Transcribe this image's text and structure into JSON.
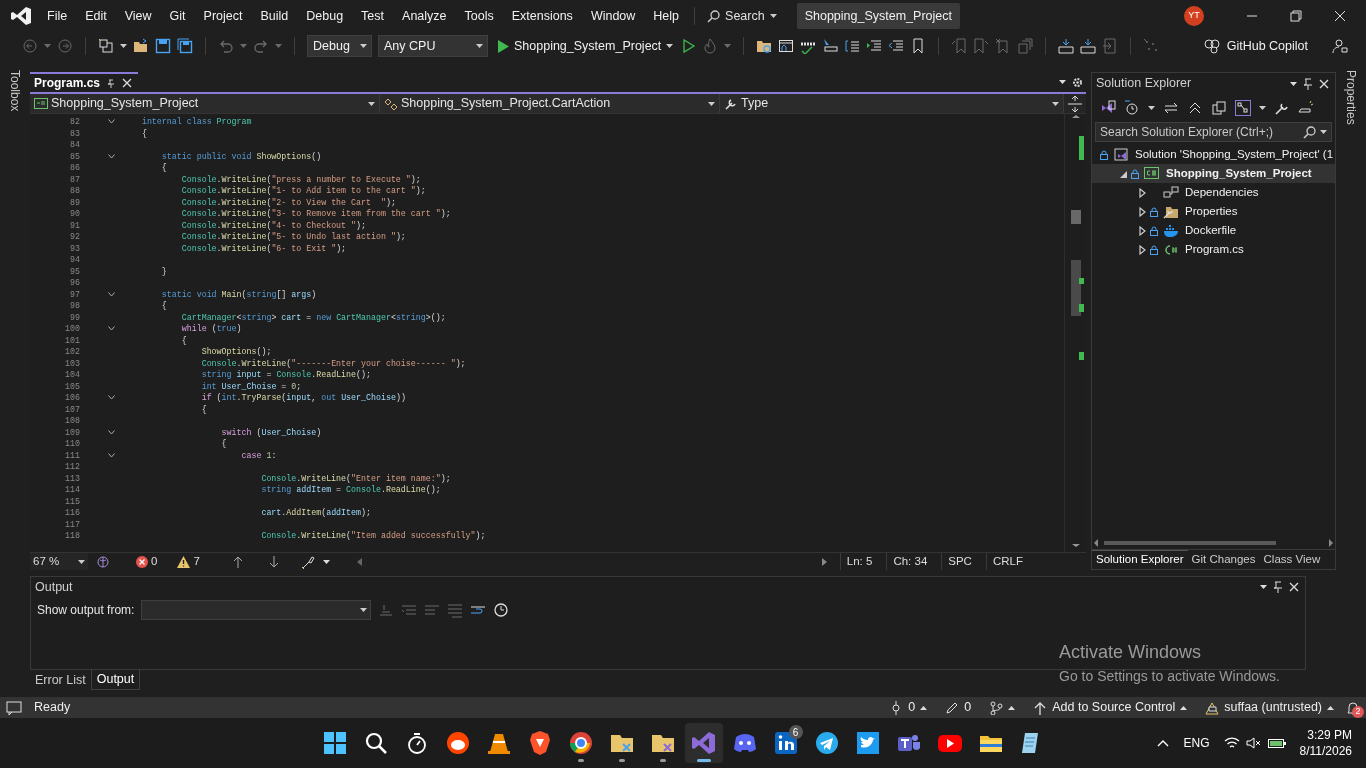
{
  "menu_bar": {
    "items": [
      "File",
      "Edit",
      "View",
      "Git",
      "Project",
      "Build",
      "Debug",
      "Test",
      "Analyze",
      "Tools",
      "Extensions",
      "Window",
      "Help"
    ],
    "search": "Search",
    "title": "Shopping_System_Project",
    "avatar": "YT"
  },
  "toolbar": {
    "configuration": "Debug",
    "platform": "Any CPU",
    "start_target": "Shopping_System_Project",
    "copilot": "GitHub Copilot"
  },
  "side_tabs": {
    "left": "Toolbox",
    "right": "Properties"
  },
  "editor": {
    "tabs": [
      {
        "label": "Program.cs",
        "selected": true
      }
    ],
    "nav": [
      "Shopping_System_Project",
      "Shopping_System_Project.CartAction",
      "Type"
    ],
    "lines": [
      {
        "number": "82",
        "fold": true,
        "tokens": [
          {
            "kind": "kw",
            "text": "    internal class "
          },
          {
            "kind": "type",
            "text": "Program"
          }
        ]
      },
      {
        "number": "83",
        "fold": false,
        "tokens": [
          {
            "kind": "p",
            "text": "    {"
          }
        ]
      },
      {
        "number": "84",
        "fold": false
      },
      {
        "number": "85",
        "fold": true,
        "tokens": [
          {
            "kind": "kw",
            "text": "        static public void "
          },
          {
            "kind": "method",
            "text": "ShowOptions"
          },
          {
            "kind": "p",
            "text": "()"
          }
        ]
      },
      {
        "number": "86",
        "fold": false,
        "tokens": [
          {
            "kind": "p",
            "text": "        {"
          }
        ]
      },
      {
        "number": "87",
        "fold": false,
        "tokens": [
          {
            "kind": "type",
            "text": "            Console"
          },
          {
            "kind": "p",
            "text": "."
          },
          {
            "kind": "method",
            "text": "WriteLine"
          },
          {
            "kind": "p",
            "text": "("
          },
          {
            "kind": "str",
            "text": "\"press a number to Execute \""
          },
          {
            "kind": "p",
            "text": ");"
          }
        ]
      },
      {
        "number": "88",
        "fold": false,
        "tokens": [
          {
            "kind": "type",
            "text": "            Console"
          },
          {
            "kind": "p",
            "text": "."
          },
          {
            "kind": "method",
            "text": "WriteLine"
          },
          {
            "kind": "p",
            "text": "("
          },
          {
            "kind": "str",
            "text": "\"1- to Add item to the cart \""
          },
          {
            "kind": "p",
            "text": ");"
          }
        ]
      },
      {
        "number": "89",
        "fold": false,
        "tokens": [
          {
            "kind": "type",
            "text": "            Console"
          },
          {
            "kind": "p",
            "text": "."
          },
          {
            "kind": "method",
            "text": "WriteLine"
          },
          {
            "kind": "p",
            "text": "("
          },
          {
            "kind": "str",
            "text": "\"2- to View the Cart  \""
          },
          {
            "kind": "p",
            "text": ");"
          }
        ]
      },
      {
        "number": "90",
        "fold": false,
        "tokens": [
          {
            "kind": "type",
            "text": "            Console"
          },
          {
            "kind": "p",
            "text": "."
          },
          {
            "kind": "method",
            "text": "WriteLine"
          },
          {
            "kind": "p",
            "text": "("
          },
          {
            "kind": "str",
            "text": "\"3- to Remove item from the cart \""
          },
          {
            "kind": "p",
            "text": ");"
          }
        ]
      },
      {
        "number": "91",
        "fold": false,
        "tokens": [
          {
            "kind": "type",
            "text": "            Console"
          },
          {
            "kind": "p",
            "text": "."
          },
          {
            "kind": "method",
            "text": "WriteLine"
          },
          {
            "kind": "p",
            "text": "("
          },
          {
            "kind": "str",
            "text": "\"4- to Checkout \""
          },
          {
            "kind": "p",
            "text": ");"
          }
        ]
      },
      {
        "number": "92",
        "fold": false,
        "tokens": [
          {
            "kind": "type",
            "text": "            Console"
          },
          {
            "kind": "p",
            "text": "."
          },
          {
            "kind": "method",
            "text": "WriteLine"
          },
          {
            "kind": "p",
            "text": "("
          },
          {
            "kind": "str",
            "text": "\"5- to Undo last action \""
          },
          {
            "kind": "p",
            "text": ");"
          }
        ]
      },
      {
        "number": "93",
        "fold": false,
        "tokens": [
          {
            "kind": "type",
            "text": "            Console"
          },
          {
            "kind": "p",
            "text": "."
          },
          {
            "kind": "method",
            "text": "WriteLine"
          },
          {
            "kind": "p",
            "text": "("
          },
          {
            "kind": "str",
            "text": "\"6- to Exit \""
          },
          {
            "kind": "p",
            "text": ");"
          }
        ]
      },
      {
        "number": "94",
        "fold": false
      },
      {
        "number": "95",
        "fold": false,
        "tokens": [
          {
            "kind": "p",
            "text": "        }"
          }
        ]
      },
      {
        "number": "96",
        "fold": false
      },
      {
        "number": "97",
        "fold": true,
        "tokens": [
          {
            "kind": "kw",
            "text": "        static void "
          },
          {
            "kind": "method",
            "text": "Main"
          },
          {
            "kind": "p",
            "text": "("
          },
          {
            "kind": "kw",
            "text": "string"
          },
          {
            "kind": "p",
            "text": "[] "
          },
          {
            "kind": "var",
            "text": "args"
          },
          {
            "kind": "p",
            "text": ")"
          }
        ]
      },
      {
        "number": "98",
        "fold": false,
        "tokens": [
          {
            "kind": "p",
            "text": "        {"
          }
        ]
      },
      {
        "number": "99",
        "fold": false,
        "tokens": [
          {
            "kind": "type",
            "text": "            CartManager"
          },
          {
            "kind": "p",
            "text": "<"
          },
          {
            "kind": "kw",
            "text": "string"
          },
          {
            "kind": "p",
            "text": "> "
          },
          {
            "kind": "var",
            "text": "cart"
          },
          {
            "kind": "p",
            "text": " = "
          },
          {
            "kind": "kw",
            "text": "new "
          },
          {
            "kind": "type",
            "text": "CartManager"
          },
          {
            "kind": "p",
            "text": "<"
          },
          {
            "kind": "kw",
            "text": "string"
          },
          {
            "kind": "p",
            "text": ">();"
          }
        ]
      },
      {
        "number": "100",
        "fold": true,
        "tokens": [
          {
            "kind": "ctl",
            "text": "            while"
          },
          {
            "kind": "p",
            "text": " ("
          },
          {
            "kind": "kw",
            "text": "true"
          },
          {
            "kind": "p",
            "text": ")"
          }
        ]
      },
      {
        "number": "101",
        "fold": false,
        "tokens": [
          {
            "kind": "p",
            "text": "            {"
          }
        ]
      },
      {
        "number": "102",
        "fold": false,
        "tokens": [
          {
            "kind": "method",
            "text": "                ShowOptions"
          },
          {
            "kind": "p",
            "text": "();"
          }
        ]
      },
      {
        "number": "103",
        "fold": false,
        "tokens": [
          {
            "kind": "type",
            "text": "                Console"
          },
          {
            "kind": "p",
            "text": "."
          },
          {
            "kind": "method",
            "text": "WriteLine"
          },
          {
            "kind": "p",
            "text": "("
          },
          {
            "kind": "str",
            "text": "\"-------Enter your choise------ \""
          },
          {
            "kind": "p",
            "text": ");"
          }
        ]
      },
      {
        "number": "104",
        "fold": false,
        "tokens": [
          {
            "kind": "kw",
            "text": "                string "
          },
          {
            "kind": "var",
            "text": "input"
          },
          {
            "kind": "p",
            "text": " = "
          },
          {
            "kind": "type",
            "text": "Console"
          },
          {
            "kind": "p",
            "text": "."
          },
          {
            "kind": "method",
            "text": "ReadLine"
          },
          {
            "kind": "p",
            "text": "();"
          }
        ]
      },
      {
        "number": "105",
        "fold": false,
        "tokens": [
          {
            "kind": "kw",
            "text": "                int "
          },
          {
            "kind": "var",
            "text": "User_Choise"
          },
          {
            "kind": "p",
            "text": " = "
          },
          {
            "kind": "num",
            "text": "0"
          },
          {
            "kind": "p",
            "text": ";"
          }
        ]
      },
      {
        "number": "106",
        "fold": true,
        "tokens": [
          {
            "kind": "ctl",
            "text": "                if"
          },
          {
            "kind": "p",
            "text": " ("
          },
          {
            "kind": "kw",
            "text": "int"
          },
          {
            "kind": "p",
            "text": "."
          },
          {
            "kind": "method",
            "text": "TryParse"
          },
          {
            "kind": "p",
            "text": "("
          },
          {
            "kind": "var",
            "text": "input"
          },
          {
            "kind": "p",
            "text": ", "
          },
          {
            "kind": "kw",
            "text": "out "
          },
          {
            "kind": "var",
            "text": "User_Choise"
          },
          {
            "kind": "p",
            "text": "))"
          }
        ]
      },
      {
        "number": "107",
        "fold": false,
        "tokens": [
          {
            "kind": "p",
            "text": "                {"
          }
        ]
      },
      {
        "number": "108",
        "fold": false
      },
      {
        "number": "109",
        "fold": true,
        "tokens": [
          {
            "kind": "ctl",
            "text": "                    switch"
          },
          {
            "kind": "p",
            "text": " ("
          },
          {
            "kind": "var",
            "text": "User_Choise"
          },
          {
            "kind": "p",
            "text": ")"
          }
        ]
      },
      {
        "number": "110",
        "fold": false,
        "tokens": [
          {
            "kind": "p",
            "text": "                    {"
          }
        ]
      },
      {
        "number": "111",
        "fold": true,
        "tokens": [
          {
            "kind": "ctl",
            "text": "                        case "
          },
          {
            "kind": "num",
            "text": "1"
          },
          {
            "kind": "p",
            "text": ":"
          }
        ]
      },
      {
        "number": "112",
        "fold": false
      },
      {
        "number": "113",
        "fold": false,
        "tokens": [
          {
            "kind": "type",
            "text": "                            Console"
          },
          {
            "kind": "p",
            "text": "."
          },
          {
            "kind": "method",
            "text": "WriteLine"
          },
          {
            "kind": "p",
            "text": "("
          },
          {
            "kind": "str",
            "text": "\"Enter item name:\""
          },
          {
            "kind": "p",
            "text": ");"
          }
        ]
      },
      {
        "number": "114",
        "fold": false,
        "tokens": [
          {
            "kind": "kw",
            "text": "                            string "
          },
          {
            "kind": "var",
            "text": "addItem"
          },
          {
            "kind": "p",
            "text": " = "
          },
          {
            "kind": "type",
            "text": "Console"
          },
          {
            "kind": "p",
            "text": "."
          },
          {
            "kind": "method",
            "text": "ReadLine"
          },
          {
            "kind": "p",
            "text": "();"
          }
        ]
      },
      {
        "number": "115",
        "fold": false
      },
      {
        "number": "116",
        "fold": false,
        "tokens": [
          {
            "kind": "var",
            "text": "                            cart"
          },
          {
            "kind": "p",
            "text": "."
          },
          {
            "kind": "method",
            "text": "AddItem"
          },
          {
            "kind": "p",
            "text": "("
          },
          {
            "kind": "var",
            "text": "addItem"
          },
          {
            "kind": "p",
            "text": ");"
          }
        ]
      },
      {
        "number": "117",
        "fold": false
      },
      {
        "number": "118",
        "fold": false,
        "tokens": [
          {
            "kind": "type",
            "text": "                            Console"
          },
          {
            "kind": "p",
            "text": "."
          },
          {
            "kind": "method",
            "text": "WriteLine"
          },
          {
            "kind": "p",
            "text": "("
          },
          {
            "kind": "str",
            "text": "\"Item added successfully\""
          },
          {
            "kind": "p",
            "text": ");"
          }
        ]
      }
    ],
    "status": {
      "zoom": "67 %",
      "errors": "0",
      "warnings": "7",
      "line": "Ln: 5",
      "column": "Ch: 34",
      "whitespace": "SPC",
      "line_endings": "CRLF"
    }
  },
  "solution_explorer": {
    "title": "Solution Explorer",
    "placeholder": "Search Solution Explorer (Ctrl+;)",
    "tree": [
      {
        "label": "Solution 'Shopping_System_Project' (1",
        "kind": "solution",
        "locked": true,
        "selected": false,
        "children": [
          {
            "label": "Shopping_System_Project",
            "kind": "project",
            "locked": true,
            "expanded": true,
            "selected": true,
            "children": [
              {
                "label": "Dependencies",
                "kind": "dependencies",
                "locked": false,
                "expanded": false,
                "selected": false
              },
              {
                "label": "Properties",
                "kind": "properties",
                "locked": true,
                "expanded": false,
                "selected": false
              },
              {
                "label": "Dockerfile",
                "kind": "docker",
                "locked": true,
                "expanded": false,
                "selected": false
              },
              {
                "label": "Program.cs",
                "kind": "csharp",
                "locked": true,
                "expanded": false,
                "selected": false
              }
            ]
          }
        ]
      }
    ],
    "tabs": [
      {
        "label": "Solution Explorer",
        "selected": true
      },
      {
        "label": "Git Changes",
        "selected": false
      },
      {
        "label": "Class View",
        "selected": false
      }
    ]
  },
  "output": {
    "title": "Output",
    "source_label": "Show output from:",
    "tabs": [
      {
        "label": "Error List",
        "selected": false
      },
      {
        "label": "Output",
        "selected": true
      }
    ]
  },
  "activation": {
    "title": "Activate Windows",
    "message": "Go to Settings to activate Windows."
  },
  "status_bar": {
    "state": "Ready",
    "commits": "0",
    "changes": "0",
    "source_control": "Add to Source Control",
    "repository": "suffaa (untrusted)",
    "notifications": "2"
  },
  "taskbar": {
    "apps": [
      {
        "kind": "start",
        "running": false
      },
      {
        "kind": "search",
        "running": false
      },
      {
        "kind": "stopwatch",
        "running": false
      },
      {
        "kind": "reddit",
        "running": false
      },
      {
        "kind": "vlc",
        "running": false
      },
      {
        "kind": "brave",
        "running": false
      },
      {
        "kind": "chrome",
        "running": true
      },
      {
        "kind": "diff",
        "running": true
      },
      {
        "kind": "diff2",
        "running": true
      },
      {
        "kind": "vs",
        "running": true
      },
      {
        "kind": "discord",
        "running": false
      },
      {
        "kind": "linkedin",
        "running": false,
        "badge": "6"
      },
      {
        "kind": "telegram",
        "running": false
      },
      {
        "kind": "twitter",
        "running": false
      },
      {
        "kind": "teams",
        "running": false
      },
      {
        "kind": "youtube",
        "running": false
      },
      {
        "kind": "explorer",
        "running": false
      },
      {
        "kind": "notepad",
        "running": false
      }
    ],
    "language": "ENG",
    "time": "3:29 PM",
    "date": "8/11/2026"
  }
}
